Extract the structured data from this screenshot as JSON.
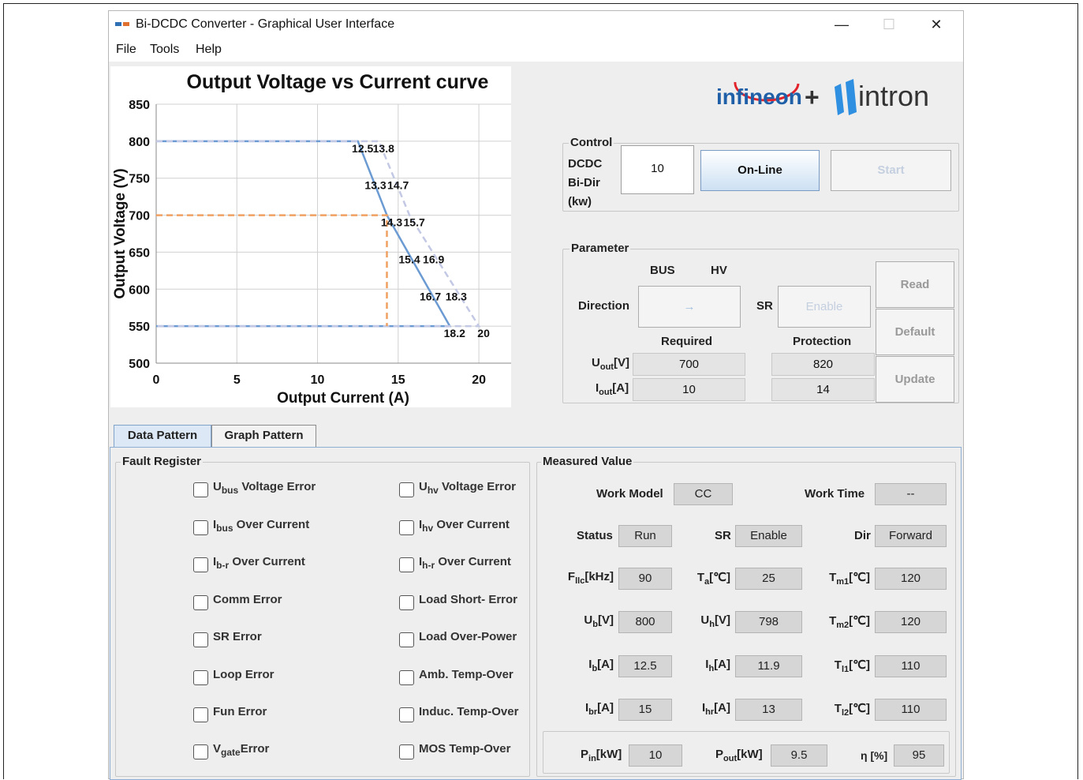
{
  "window": {
    "title": "Bi-DCDC Converter - Graphical User Interface",
    "minimize": "—",
    "maximize": "☐",
    "close": "✕"
  },
  "menu": [
    "File",
    "Tools",
    "Help"
  ],
  "logos": {
    "left": "infineon",
    "plus": "+",
    "right": "intron"
  },
  "chart_data": {
    "type": "line",
    "title": "Output Voltage vs Current curve",
    "xlabel": "Output Current (A)",
    "ylabel": "Output Voltage (V)",
    "xlim": [
      0,
      22
    ],
    "ylim": [
      500,
      850
    ],
    "xticks": [
      0,
      5,
      10,
      15,
      20
    ],
    "yticks": [
      500,
      550,
      600,
      650,
      700,
      750,
      800,
      850
    ],
    "grid": true,
    "series": [
      {
        "style": "solid",
        "color": "#6b9bd2",
        "points": [
          [
            0,
            800
          ],
          [
            12.5,
            800
          ],
          [
            14.3,
            700
          ],
          [
            18.2,
            550
          ],
          [
            0,
            550
          ]
        ]
      },
      {
        "style": "dashed",
        "color": "#c3c8e4",
        "points": [
          [
            0,
            800
          ],
          [
            13.8,
            800
          ],
          [
            15.7,
            700
          ],
          [
            20,
            550
          ],
          [
            0,
            550
          ]
        ]
      },
      {
        "style": "dashed",
        "color": "#f0a060",
        "points": [
          [
            0,
            700
          ],
          [
            14.3,
            700
          ],
          [
            14.3,
            550
          ]
        ]
      }
    ],
    "annotations": [
      {
        "x": 12.5,
        "y": 800,
        "text": "12.5"
      },
      {
        "x": 13.8,
        "y": 800,
        "text": "13.8"
      },
      {
        "x": 13.3,
        "y": 750,
        "text": "13.3"
      },
      {
        "x": 14.7,
        "y": 750,
        "text": "14.7"
      },
      {
        "x": 14.3,
        "y": 700,
        "text": "14.3"
      },
      {
        "x": 15.7,
        "y": 700,
        "text": "15.7"
      },
      {
        "x": 15.4,
        "y": 650,
        "text": "15.4"
      },
      {
        "x": 16.9,
        "y": 650,
        "text": "16.9"
      },
      {
        "x": 16.7,
        "y": 600,
        "text": "16.7"
      },
      {
        "x": 18.3,
        "y": 600,
        "text": "18.3"
      },
      {
        "x": 18.2,
        "y": 550,
        "text": "18.2"
      },
      {
        "x": 20,
        "y": 550,
        "text": "20"
      }
    ]
  },
  "control": {
    "label": "Control",
    "dcdc_label_1": "DCDC",
    "dcdc_label_2": "Bi-Dir",
    "dcdc_label_3": "(kw)",
    "power_value": "10",
    "online_button": "On-Line",
    "start_button": "Start"
  },
  "parameter": {
    "label": "Parameter",
    "bus": "BUS",
    "hv": "HV",
    "direction_label": "Direction",
    "direction_arrow": "→",
    "sr_label": "SR",
    "sr_button": "Enable",
    "required_label": "Required",
    "protection_label": "Protection",
    "uout_main": "U",
    "uout_sub": "out",
    "uout_unit": "[V]",
    "iout_main": "I",
    "iout_sub": "out",
    "iout_unit": "[A]",
    "uout_required": "700",
    "iout_required": "10",
    "uout_protection": "820",
    "iout_protection": "14",
    "read_button": "Read",
    "default_button": "Default",
    "update_button": "Update"
  },
  "tabs": [
    "Data Pattern",
    "Graph Pattern"
  ],
  "fault_register": {
    "label": "Fault Register",
    "left": [
      {
        "main": "U",
        "sub": "bus",
        "rest": " Voltage Error"
      },
      {
        "main": "I",
        "sub": "bus",
        "rest": " Over Current"
      },
      {
        "main": "I",
        "sub": "b-r",
        "rest": " Over Current"
      },
      {
        "main": "Comm Error",
        "sub": "",
        "rest": ""
      },
      {
        "main": "SR Error",
        "sub": "",
        "rest": ""
      },
      {
        "main": "Loop Error",
        "sub": "",
        "rest": ""
      },
      {
        "main": "Fun Error",
        "sub": "",
        "rest": ""
      },
      {
        "main": "V",
        "sub": "gate",
        "rest": "Error"
      }
    ],
    "right": [
      {
        "main": "U",
        "sub": "hv",
        "rest": " Voltage Error"
      },
      {
        "main": "I",
        "sub": "hv",
        "rest": " Over Current"
      },
      {
        "main": "I",
        "sub": "h-r",
        "rest": " Over Current"
      },
      {
        "main": "Load Short- Error",
        "sub": "",
        "rest": ""
      },
      {
        "main": "Load Over-Power",
        "sub": "",
        "rest": ""
      },
      {
        "main": "Amb. Temp-Over",
        "sub": "",
        "rest": ""
      },
      {
        "main": "Induc. Temp-Over",
        "sub": "",
        "rest": ""
      },
      {
        "main": "MOS Temp-Over",
        "sub": "",
        "rest": ""
      }
    ]
  },
  "measured": {
    "label": "Measured Value",
    "work_model_label": "Work Model",
    "work_model": "CC",
    "work_time_label": "Work Time",
    "work_time": "--",
    "status_label": "Status",
    "status": "Run",
    "sr_label": "SR",
    "sr": "Enable",
    "dir_label": "Dir",
    "dir": "Forward",
    "rows": [
      [
        {
          "main": "F",
          "sub": "llc",
          "unit": "[kHz]",
          "value": "90"
        },
        {
          "main": "T",
          "sub": "a",
          "unit": "[℃]",
          "value": "25"
        },
        {
          "main": "T",
          "sub": "m1",
          "unit": "[℃]",
          "value": "120"
        }
      ],
      [
        {
          "main": "U",
          "sub": "b",
          "unit": "[V]",
          "value": "800"
        },
        {
          "main": "U",
          "sub": "h",
          "unit": "[V]",
          "value": "798"
        },
        {
          "main": "T",
          "sub": "m2",
          "unit": "[℃]",
          "value": "120"
        }
      ],
      [
        {
          "main": "I",
          "sub": "b",
          "unit": "[A]",
          "value": "12.5"
        },
        {
          "main": "I",
          "sub": "h",
          "unit": "[A]",
          "value": "11.9"
        },
        {
          "main": "T",
          "sub": "l1",
          "unit": "[℃]",
          "value": "110"
        }
      ],
      [
        {
          "main": "I",
          "sub": "br",
          "unit": "[A]",
          "value": "15"
        },
        {
          "main": "I",
          "sub": "hr",
          "unit": "[A]",
          "value": "13"
        },
        {
          "main": "T",
          "sub": "l2",
          "unit": "[℃]",
          "value": "110"
        }
      ]
    ],
    "pin": {
      "main": "P",
      "sub": "in",
      "unit": "[kW]",
      "value": "10"
    },
    "pout": {
      "main": "P",
      "sub": "out",
      "unit": "[kW]",
      "value": "9.5"
    },
    "eta": {
      "main": "η [%]",
      "sub": "",
      "unit": "",
      "value": "95"
    }
  }
}
